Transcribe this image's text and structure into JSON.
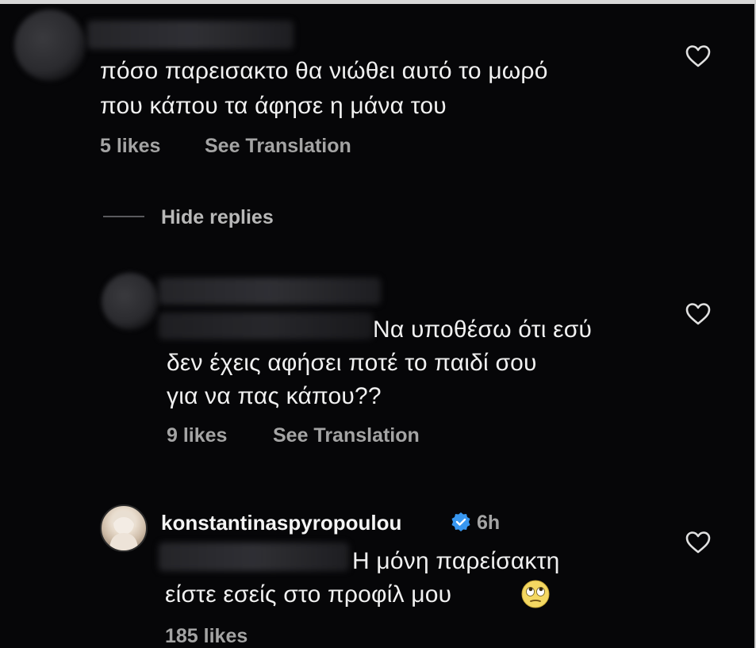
{
  "comments": [
    {
      "text_lines": [
        "πόσο παρεισακτο θα νιώθει αυτό το μωρό",
        "που κάπου τα άφησε η μάνα του"
      ],
      "likes": "5 likes",
      "translation": "See Translation"
    }
  ],
  "replies_toggle": "Hide replies",
  "replies": [
    {
      "text_lines": [
        "Να υποθέσω ότι εσύ",
        "δεν έχεις αφήσει ποτέ το παιδί σου",
        "για να πας κάπου??"
      ],
      "likes": "9 likes",
      "translation": "See Translation"
    },
    {
      "username": "konstantinaspyropoulou",
      "time": "6h",
      "text_lines": [
        "Η μόνη παρείσακτη",
        "είστε εσείς στο προφίλ μου"
      ],
      "likes": "185 likes"
    }
  ],
  "icons": {
    "heart": "heart-icon",
    "verified": "verified-badge-icon",
    "emoji": "face-with-rolling-eyes-emoji"
  },
  "colors": {
    "background": "#060608",
    "text": "#f0f0f0",
    "meta": "#a4a4a4",
    "verified": "#3897f0"
  }
}
